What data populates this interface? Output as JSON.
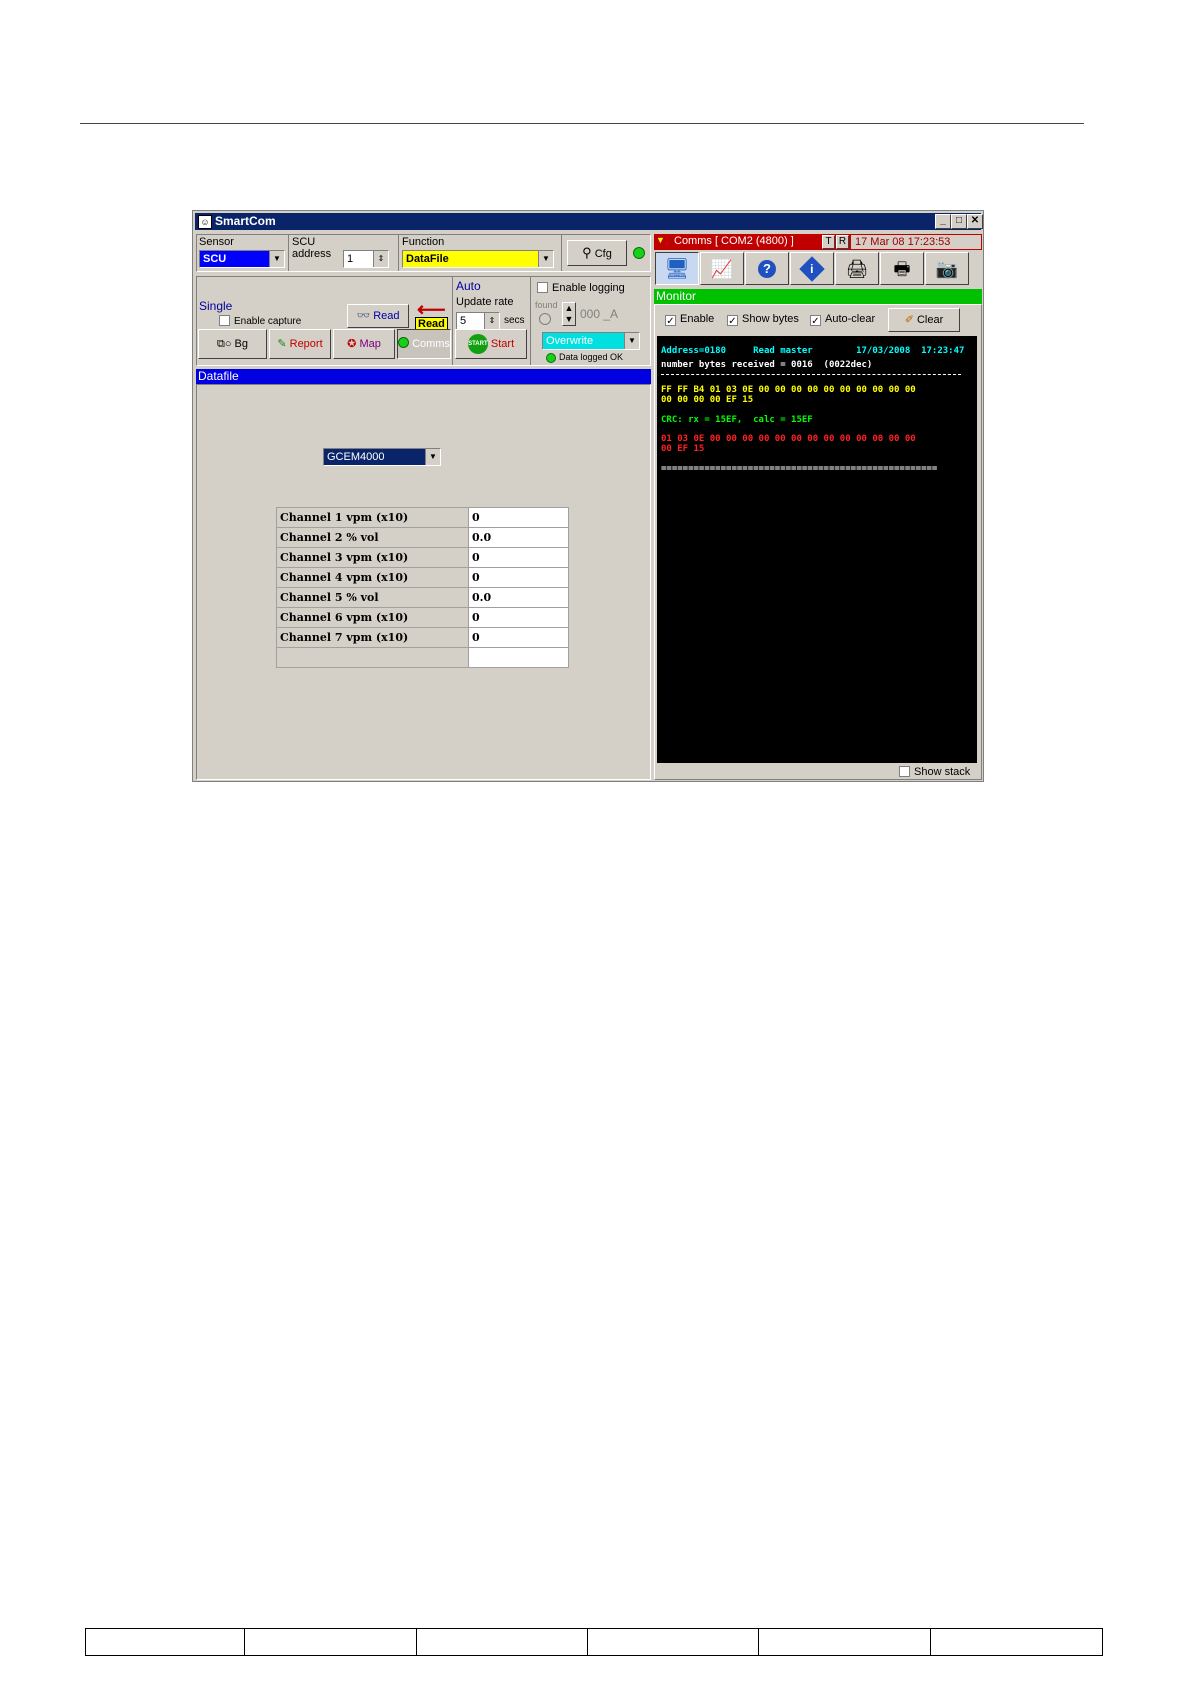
{
  "window": {
    "title": "SmartCom"
  },
  "sensor": {
    "label": "Sensor",
    "value": "SCU"
  },
  "scu": {
    "label": "SCU\naddress",
    "value": "1"
  },
  "function": {
    "label": "Function",
    "value": "DataFile"
  },
  "cfg_button": "Cfg",
  "single": {
    "label": "Single",
    "enable_capture": "Enable capture",
    "read_button": "Read",
    "read_badge": "Read"
  },
  "auto": {
    "label": "Auto",
    "update_rate": "Update rate",
    "rate_value": "5",
    "secs": "secs",
    "start_button": "Start",
    "start_icon_text": "START"
  },
  "logging": {
    "enable_logging": "Enable logging",
    "found": "found",
    "counter": "000 _A",
    "mode": "Overwrite",
    "status": "Data logged OK"
  },
  "toolbar": {
    "bg": "Bg",
    "report": "Report",
    "map": "Map",
    "comms": "Comms"
  },
  "comms": {
    "title": "Comms [ COM2 (4800) ]",
    "t": "T",
    "r": "R",
    "datetime": "17 Mar 08  17:23:53"
  },
  "datafile": {
    "title": "Datafile",
    "device": "GCEM4000"
  },
  "channels": [
    {
      "name": "Channel 1  vpm (x10)",
      "value": "0"
    },
    {
      "name": "Channel 2  % vol",
      "value": "0.0"
    },
    {
      "name": "Channel 3  vpm (x10)",
      "value": "0"
    },
    {
      "name": "Channel 4  vpm (x10)",
      "value": "0"
    },
    {
      "name": "Channel 5  % vol",
      "value": "0.0"
    },
    {
      "name": "Channel 6  vpm (x10)",
      "value": "0"
    },
    {
      "name": "Channel 7  vpm (x10)",
      "value": "0"
    },
    {
      "name": "",
      "value": ""
    }
  ],
  "monitor": {
    "title": "Monitor",
    "enable": "Enable",
    "show_bytes": "Show bytes",
    "auto_clear": "Auto-clear",
    "clear": "Clear",
    "show_stack": "Show stack",
    "address_line": "Address=0180     Read master        17/03/2008  17:23:47",
    "bytes_line": "number bytes received = 0016  (0022dec)",
    "hex1": "FF FF B4 01 03 0E 00 00 00 00 00 00 00 00 00 00",
    "hex2": "00 00 00 00 EF 15",
    "crc": "CRC: rx = 15EF,  calc = 15EF",
    "red1": "01 03 0E 00 00 00 00 00 00 00 00 00 00 00 00 00",
    "red2": "00 EF 15",
    "separator": "==================================================="
  },
  "colors": {
    "title_bar": "#0a246a",
    "sensor_bg": "#0000ff",
    "function_bg": "#ffff00",
    "comms_bg": "#c00000",
    "monitor_bar": "#00c000",
    "datafile_bar": "#0000e0",
    "cyan": "#00ffff",
    "yellow": "#ffff00",
    "green": "#00ff00",
    "red": "#ff2020"
  }
}
